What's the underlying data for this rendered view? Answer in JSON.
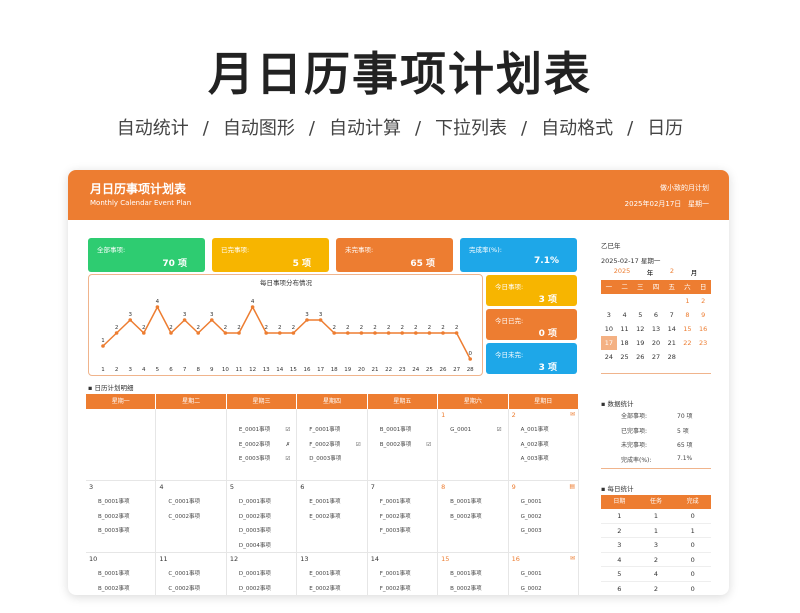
{
  "page": {
    "big_title": "月日历事项计划表",
    "subtitle": [
      "自动统计",
      "/",
      "自动图形",
      "/",
      "自动计算",
      "/",
      "下拉列表",
      "/",
      "自动格式",
      "/",
      "日历"
    ]
  },
  "header": {
    "title": "月日历事项计划表",
    "subtitle_en": "Monthly Calendar Event Plan",
    "author": "做小致的月计划",
    "date": "2025年02月17日",
    "weekday": "星期一"
  },
  "stats": [
    {
      "label": "全部事项:",
      "value": "70 项",
      "color": "#2ecc71"
    },
    {
      "label": "已完事项:",
      "value": "5 项",
      "color": "#f7b500"
    },
    {
      "label": "未完事项:",
      "value": "65 项",
      "color": "#ed7d31"
    },
    {
      "label": "完成率(%):",
      "value": "7.1%",
      "color": "#1ea7e8"
    }
  ],
  "today_stats": [
    {
      "label": "今日事项:",
      "value": "3 项",
      "color": "#f7b500"
    },
    {
      "label": "今日已完:",
      "value": "0 项",
      "color": "#ed7d31"
    },
    {
      "label": "今日未完:",
      "value": "3 项",
      "color": "#1ea7e8"
    }
  ],
  "chart_data": {
    "type": "line",
    "title": "每日事项分布情况",
    "x": [
      1,
      2,
      3,
      4,
      5,
      6,
      7,
      8,
      9,
      10,
      11,
      12,
      13,
      14,
      15,
      16,
      17,
      18,
      19,
      20,
      21,
      22,
      23,
      24,
      25,
      26,
      27,
      28
    ],
    "values": [
      1,
      2,
      3,
      2,
      4,
      2,
      3,
      2,
      3,
      2,
      2,
      4,
      2,
      2,
      2,
      3,
      3,
      2,
      2,
      2,
      2,
      2,
      2,
      2,
      2,
      2,
      2,
      0
    ],
    "color": "#ed7d31"
  },
  "calendar": {
    "section_title": "日历计划明细",
    "weekdays": [
      "星期一",
      "星期二",
      "星期三",
      "星期四",
      "星期五",
      "星期六",
      "星期日"
    ],
    "weeks": [
      [
        {
          "day": "",
          "items": []
        },
        {
          "day": "",
          "items": []
        },
        {
          "day": "",
          "items": [
            {
              "t": "E_0001事项",
              "m": "☑"
            },
            {
              "t": "E_0002事项",
              "m": "✗"
            },
            {
              "t": "E_0003事项",
              "m": "☑"
            }
          ]
        },
        {
          "day": "",
          "items": [
            {
              "t": "F_0001事项",
              "m": ""
            },
            {
              "t": "F_0002事项",
              "m": "☑"
            },
            {
              "t": "D_0003事项",
              "m": ""
            }
          ]
        },
        {
          "day": "",
          "items": [
            {
              "t": "B_0001事项",
              "m": ""
            },
            {
              "t": "B_0002事项",
              "m": "☑"
            }
          ]
        },
        {
          "day": "1",
          "weekend": true,
          "items": [
            {
              "t": "G_0001",
              "m": "☑"
            }
          ]
        },
        {
          "day": "2",
          "weekend": true,
          "icon": "✉",
          "items": [
            {
              "t": "A_001事项",
              "m": ""
            },
            {
              "t": "A_002事项",
              "m": ""
            },
            {
              "t": "A_003事项",
              "m": ""
            }
          ]
        }
      ],
      [
        {
          "day": "3",
          "items": [
            {
              "t": "B_0001事项",
              "m": ""
            },
            {
              "t": "B_0002事项",
              "m": ""
            },
            {
              "t": "B_0003事项",
              "m": ""
            }
          ]
        },
        {
          "day": "4",
          "items": [
            {
              "t": "C_0001事项",
              "m": ""
            },
            {
              "t": "C_0002事项",
              "m": ""
            }
          ]
        },
        {
          "day": "5",
          "items": [
            {
              "t": "D_0001事项",
              "m": ""
            },
            {
              "t": "D_0002事项",
              "m": ""
            },
            {
              "t": "D_0003事项",
              "m": ""
            },
            {
              "t": "D_0004事项",
              "m": ""
            }
          ]
        },
        {
          "day": "6",
          "items": [
            {
              "t": "E_0001事项",
              "m": ""
            },
            {
              "t": "E_0002事项",
              "m": ""
            }
          ]
        },
        {
          "day": "7",
          "items": [
            {
              "t": "F_0001事项",
              "m": ""
            },
            {
              "t": "F_0002事项",
              "m": ""
            },
            {
              "t": "F_0003事项",
              "m": ""
            }
          ]
        },
        {
          "day": "8",
          "weekend": true,
          "items": [
            {
              "t": "B_0001事项",
              "m": ""
            },
            {
              "t": "B_0002事项",
              "m": ""
            }
          ]
        },
        {
          "day": "9",
          "weekend": true,
          "icon": "▤",
          "items": [
            {
              "t": "G_0001",
              "m": ""
            },
            {
              "t": "G_0002",
              "m": ""
            },
            {
              "t": "G_0003",
              "m": ""
            }
          ]
        }
      ],
      [
        {
          "day": "10",
          "items": [
            {
              "t": "B_0001事项",
              "m": ""
            },
            {
              "t": "B_0002事项",
              "m": ""
            }
          ]
        },
        {
          "day": "11",
          "items": [
            {
              "t": "C_0001事项",
              "m": ""
            },
            {
              "t": "C_0002事项",
              "m": ""
            }
          ]
        },
        {
          "day": "12",
          "items": [
            {
              "t": "D_0001事项",
              "m": ""
            },
            {
              "t": "D_0002事项",
              "m": ""
            }
          ]
        },
        {
          "day": "13",
          "items": [
            {
              "t": "E_0001事项",
              "m": ""
            },
            {
              "t": "E_0002事项",
              "m": ""
            }
          ]
        },
        {
          "day": "14",
          "items": [
            {
              "t": "F_0001事项",
              "m": ""
            },
            {
              "t": "F_0002事项",
              "m": ""
            }
          ]
        },
        {
          "day": "15",
          "weekend": true,
          "items": [
            {
              "t": "B_0001事项",
              "m": ""
            },
            {
              "t": "B_0002事项",
              "m": ""
            }
          ]
        },
        {
          "day": "16",
          "weekend": true,
          "icon": "✉",
          "items": [
            {
              "t": "G_0001",
              "m": ""
            },
            {
              "t": "G_0002",
              "m": ""
            }
          ]
        }
      ]
    ]
  },
  "mini_calendar": {
    "ganzhi": "乙巳年",
    "date_line": "2025-02-17  星期一",
    "year": "2025",
    "year_unit": "年",
    "month": "2",
    "month_unit": "月",
    "weekdays": [
      "一",
      "二",
      "三",
      "四",
      "五",
      "六",
      "日"
    ],
    "days": [
      "",
      "",
      "",
      "",
      "",
      "1",
      "2",
      "3",
      "4",
      "5",
      "6",
      "7",
      "8",
      "9",
      "10",
      "11",
      "12",
      "13",
      "14",
      "15",
      "16",
      "17",
      "18",
      "19",
      "20",
      "21",
      "22",
      "23",
      "24",
      "25",
      "26",
      "27",
      "28",
      "",
      "",
      "",
      "",
      ""
    ],
    "today": "17"
  },
  "summary": {
    "title": "数据统计",
    "rows": [
      {
        "k": "全部事项:",
        "v": "70 项"
      },
      {
        "k": "已完事项:",
        "v": "5 项"
      },
      {
        "k": "未完事项:",
        "v": "65 项"
      },
      {
        "k": "完成率(%):",
        "v": "7.1%"
      }
    ]
  },
  "daily": {
    "title": "每日统计",
    "headers": [
      "日期",
      "任务",
      "完成"
    ],
    "rows": [
      [
        "1",
        "1",
        "0"
      ],
      [
        "2",
        "1",
        "1"
      ],
      [
        "3",
        "3",
        "0"
      ],
      [
        "4",
        "2",
        "0"
      ],
      [
        "5",
        "4",
        "0"
      ],
      [
        "6",
        "2",
        "0"
      ]
    ]
  }
}
